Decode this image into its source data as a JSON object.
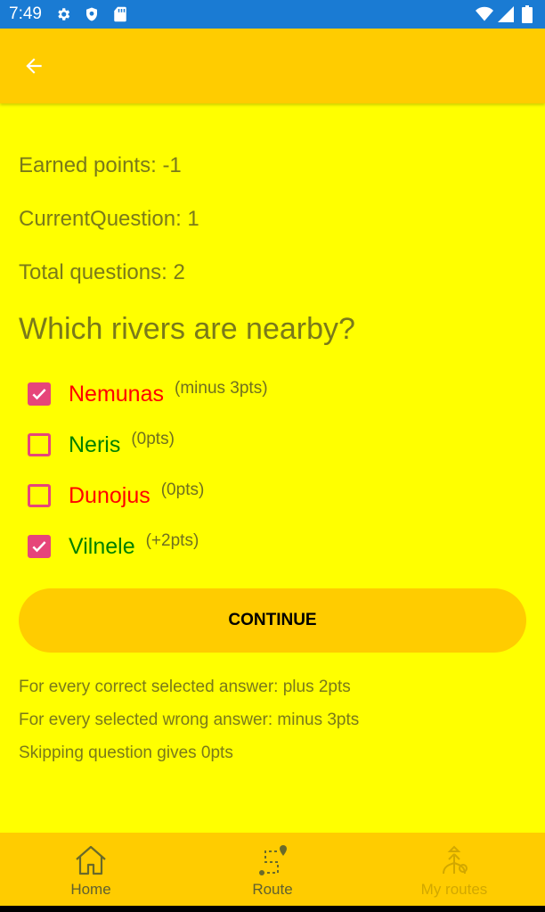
{
  "status_bar": {
    "time": "7:49",
    "icons_left": [
      "gear-icon",
      "shield-icon",
      "sd-card-icon"
    ],
    "icons_right": [
      "wifi-icon",
      "signal-icon",
      "battery-icon"
    ]
  },
  "app_bar": {
    "back_icon": "arrow-left-icon"
  },
  "stats": {
    "earned_points": "Earned points: -1",
    "current_question": "CurrentQuestion: 1",
    "total_questions": "Total questions: 2"
  },
  "question": "Which rivers are nearby?",
  "options": [
    {
      "label": "Nemunas",
      "points": "(minus 3pts)",
      "checked": true,
      "color": "#ff0000"
    },
    {
      "label": "Neris",
      "points": "(0pts)",
      "checked": false,
      "color": "#008000"
    },
    {
      "label": "Dunojus",
      "points": "(0pts)",
      "checked": false,
      "color": "#ff0000"
    },
    {
      "label": "Vilnele",
      "points": "(+2pts)",
      "checked": true,
      "color": "#008000"
    }
  ],
  "continue_label": "CONTINUE",
  "rules": [
    "For every correct selected answer: plus 2pts",
    "For every selected wrong answer: minus 3pts",
    "Skipping question gives 0pts"
  ],
  "bottom_nav": [
    {
      "label": "Home",
      "icon": "home-icon"
    },
    {
      "label": "Route",
      "icon": "route-icon"
    },
    {
      "label": "My routes",
      "icon": "my-routes-icon"
    }
  ],
  "colors": {
    "background": "#ffff00",
    "accent": "#ffcc00",
    "checkbox": "#e6457a",
    "status_bar": "#1a7bd3"
  }
}
